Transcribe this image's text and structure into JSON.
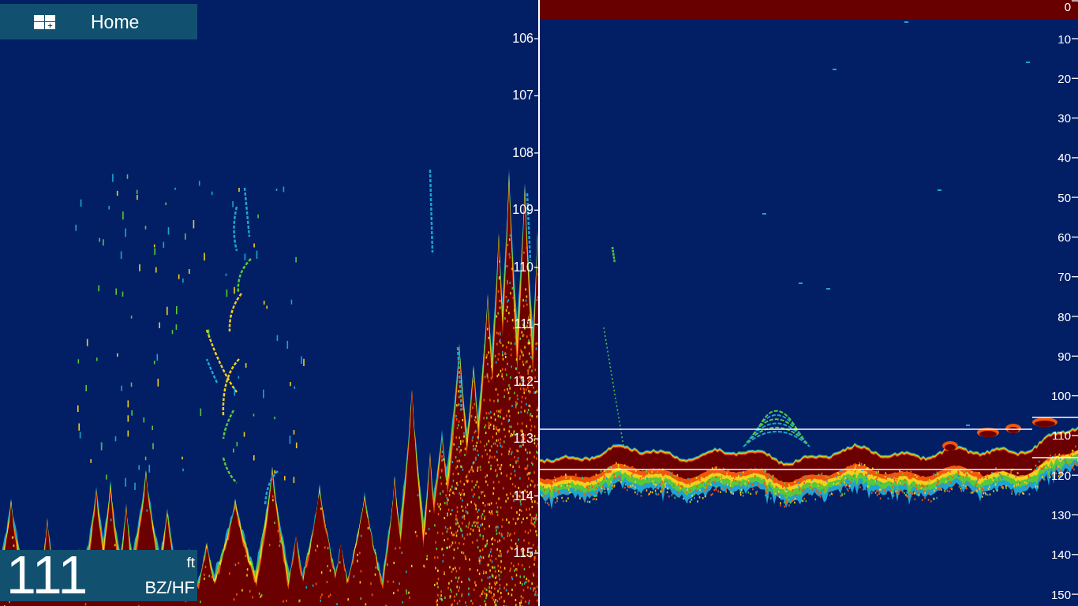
{
  "home_button": {
    "label": "Home"
  },
  "zoom_echogram": {
    "depth_scale": [
      "106",
      "107",
      "108",
      "109",
      "110",
      "111",
      "112",
      "113",
      "114",
      "115"
    ]
  },
  "depth_readout": {
    "value": "111",
    "unit": "ft",
    "mode": "BZ/HF"
  },
  "full_echogram": {
    "depth_scale": [
      "0",
      "10",
      "20",
      "30",
      "40",
      "50",
      "60",
      "70",
      "80",
      "90",
      "100",
      "110",
      "120",
      "130",
      "140",
      "150"
    ]
  }
}
